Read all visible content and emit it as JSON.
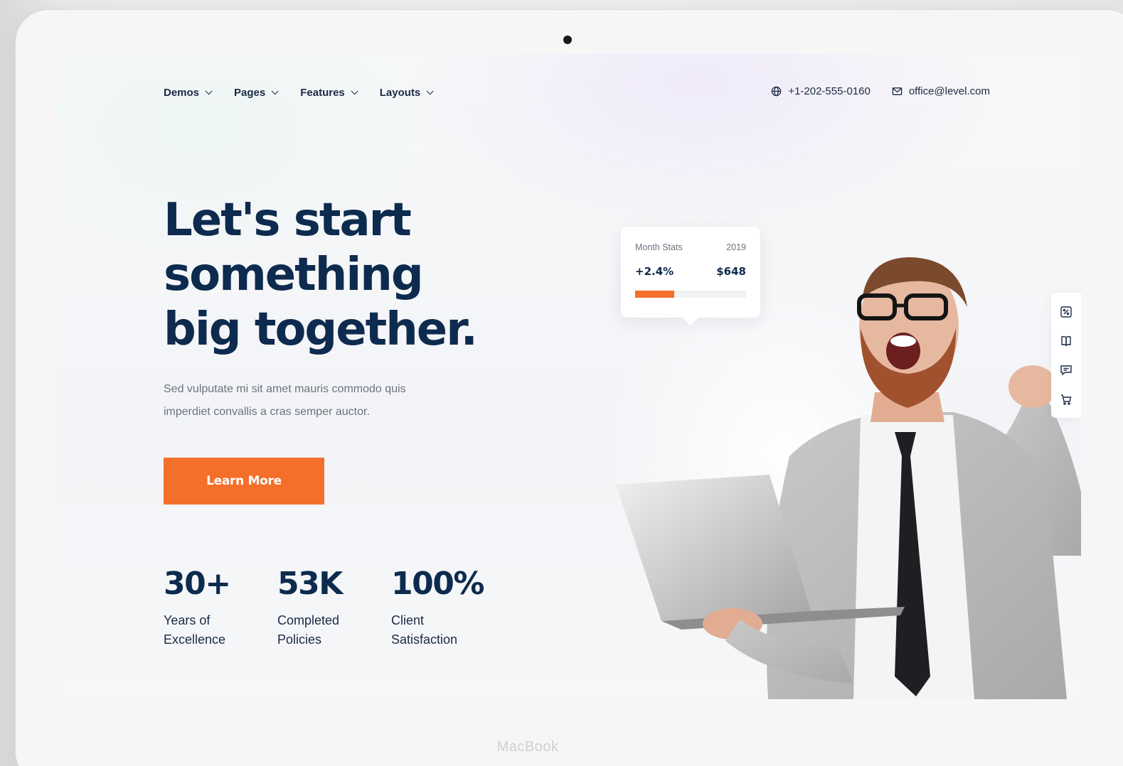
{
  "nav": {
    "items": [
      {
        "label": "Demos"
      },
      {
        "label": "Pages"
      },
      {
        "label": "Features"
      },
      {
        "label": "Layouts"
      }
    ]
  },
  "contact": {
    "phone": "+1-202-555-0160",
    "email": "office@level.com"
  },
  "hero": {
    "title_lines": [
      "Let's start",
      "something",
      "big together."
    ],
    "description_lines": [
      "Sed vulputate mi sit amet mauris commodo quis",
      "imperdiet convallis a cras semper auctor."
    ],
    "cta_label": "Learn More"
  },
  "stats": [
    {
      "value": "30+",
      "label_lines": [
        "Years of",
        "Excellence"
      ]
    },
    {
      "value": "53K",
      "label_lines": [
        "Completed",
        "Policies"
      ]
    },
    {
      "value": "100%",
      "label_lines": [
        "Client",
        "Satisfaction"
      ]
    }
  ],
  "stats_card": {
    "label": "Month Stats",
    "year": "2019",
    "change": "+2.4%",
    "amount": "$648",
    "progress_fraction": 0.35
  },
  "side_tools": [
    {
      "icon": "percent-icon"
    },
    {
      "icon": "book-icon"
    },
    {
      "icon": "chat-icon"
    },
    {
      "icon": "cart-icon"
    }
  ],
  "device": {
    "brand": "MacBook"
  },
  "colors": {
    "accent": "#f46f2a",
    "heading": "#0d2b4e",
    "text": "#1b2a44"
  }
}
